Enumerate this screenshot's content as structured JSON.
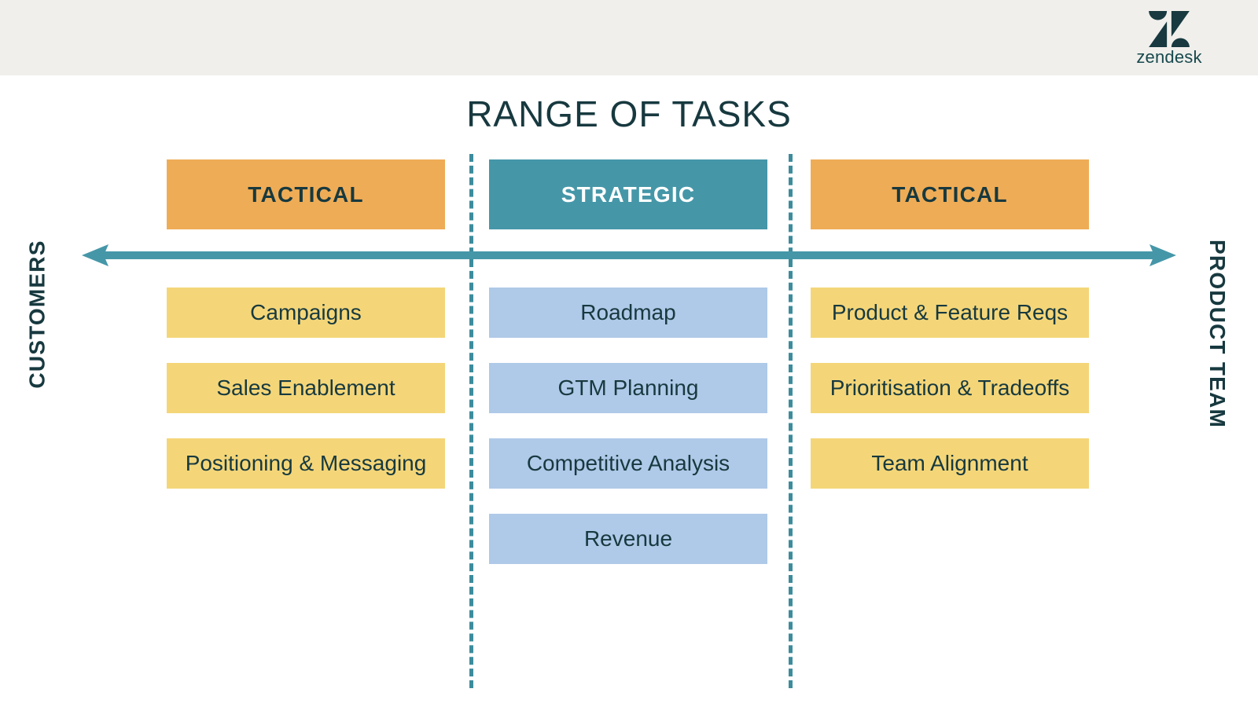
{
  "brand": {
    "name": "zendesk",
    "logo_icon": "zendesk-logo-icon",
    "band_color": "#F0EFEC"
  },
  "chart_data": {
    "type": "table",
    "title": "RANGE OF TASKS",
    "axis": {
      "left_label": "CUSTOMERS",
      "right_label": "PRODUCT TEAM",
      "arrow_icon": "double-headed-arrow-icon",
      "arrow_color": "#4597A8"
    },
    "legend": null,
    "columns": [
      {
        "header": "TACTICAL",
        "header_color": "#EFAC56",
        "header_text_color": "#17393F",
        "item_color": "#F4D679",
        "items": [
          "Campaigns",
          "Sales Enablement",
          "Positioning & Messaging"
        ]
      },
      {
        "header": "STRATEGIC",
        "header_color": "#4597A8",
        "header_text_color": "#FFFFFF",
        "item_color": "#AFC9E8",
        "items": [
          "Roadmap",
          "GTM Planning",
          "Competitive Analysis",
          "Revenue"
        ]
      },
      {
        "header": "TACTICAL",
        "header_color": "#EFAC56",
        "header_text_color": "#17393F",
        "item_color": "#F4D679",
        "items": [
          "Product & Feature Reqs",
          "Prioritisation & Tradeoffs",
          "Team Alignment"
        ]
      }
    ],
    "divider_color": "#3D8C9C",
    "divider_style": "dashed"
  }
}
